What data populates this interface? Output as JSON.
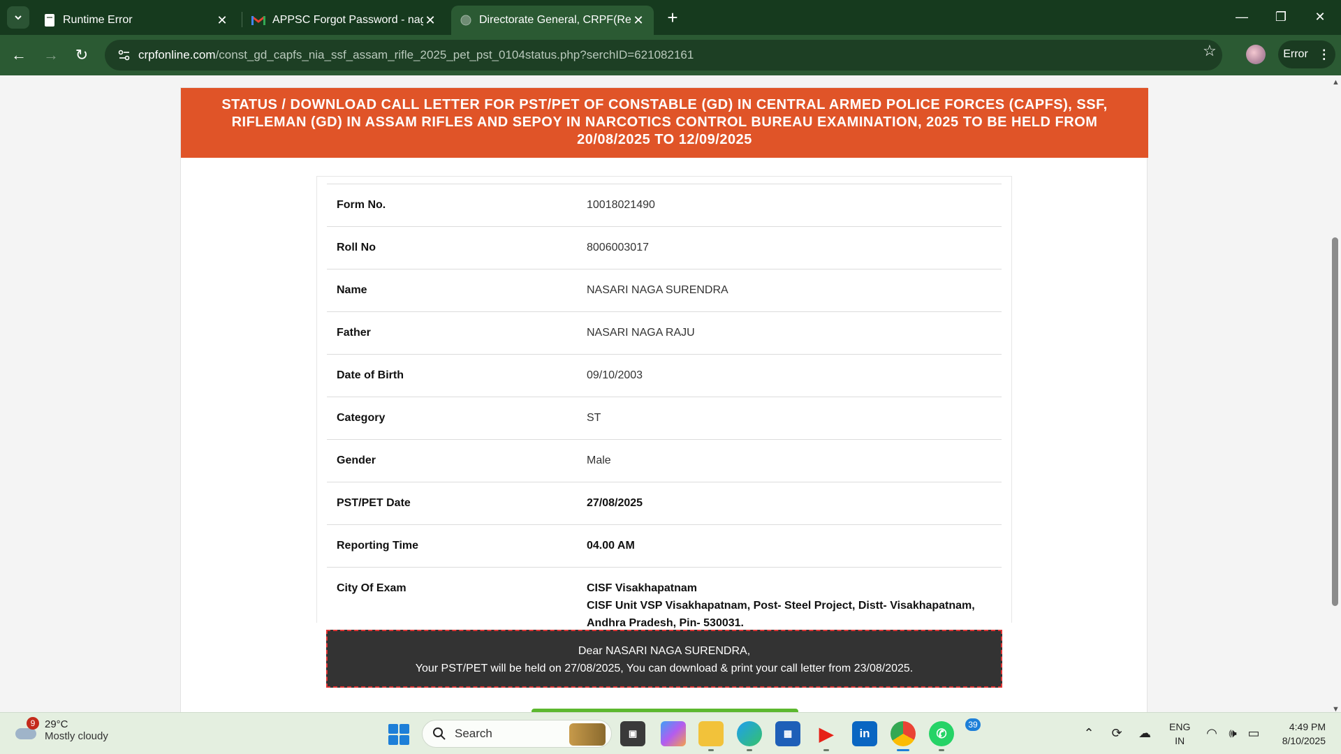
{
  "browser": {
    "tabs": [
      {
        "title": "Runtime Error",
        "icon": "document-icon"
      },
      {
        "title": "APPSC Forgot Password - naga",
        "icon": "gmail-icon"
      },
      {
        "title": "Directorate General, CRPF(Recr",
        "icon": "globe-icon",
        "active": true
      }
    ],
    "url_host": "crpfonline.com",
    "url_path": "/const_gd_capfs_nia_ssf_assam_rifle_2025_pet_pst_0104status.php?serchID=621082161",
    "error_label": "Error"
  },
  "page": {
    "banner_line1": "STATUS / DOWNLOAD CALL LETTER FOR PST/PET OF CONSTABLE (GD) IN CENTRAL ARMED POLICE FORCES (CAPFS), SSF,",
    "banner_line2": "RIFLEMAN (GD) IN ASSAM RIFLES AND SEPOY IN NARCOTICS CONTROL BUREAU EXAMINATION, 2025 TO BE HELD FROM",
    "banner_line3": "20/08/2025 TO 12/09/2025",
    "rows": {
      "form_no": {
        "label": "Form No.",
        "value": "10018021490"
      },
      "roll_no": {
        "label": "Roll No",
        "value": "8006003017"
      },
      "name": {
        "label": "Name",
        "value": "NASARI NAGA SURENDRA"
      },
      "father": {
        "label": "Father",
        "value": "NASARI NAGA RAJU"
      },
      "dob": {
        "label": "Date of Birth",
        "value": "09/10/2003"
      },
      "category": {
        "label": "Category",
        "value": "ST"
      },
      "gender": {
        "label": "Gender",
        "value": "Male"
      },
      "pst_date": {
        "label": "PST/PET Date",
        "value": "27/08/2025"
      },
      "reporting_time": {
        "label": "Reporting Time",
        "value": "04.00 AM"
      },
      "city": {
        "label": "City Of Exam",
        "value_line1": "CISF Visakhapatnam",
        "value_line2": "CISF Unit VSP Visakhapatnam, Post- Steel Project, Distt- Visakhapatnam,",
        "value_line3": "Andhra Pradesh, Pin- 530031."
      }
    },
    "notice_line1": "Dear NASARI NAGA SURENDRA,",
    "notice_line2": "Your PST/PET will be held on 27/08/2025, You can download & print your call letter from 23/08/2025."
  },
  "taskbar": {
    "weather_badge": "9",
    "temperature": "29°C",
    "condition": "Mostly cloudy",
    "search_label": "Search",
    "whatsapp_badge": "39",
    "lang_line1": "ENG",
    "lang_line2": "IN",
    "time": "4:49 PM",
    "date": "8/10/2025"
  },
  "colors": {
    "chrome_dark": "#163a1e",
    "chrome_toolbar": "#2b5a33",
    "banner": "#e05428",
    "notice_bg": "#333333",
    "notice_border": "#e03434",
    "accent_green": "#5cb82e"
  }
}
